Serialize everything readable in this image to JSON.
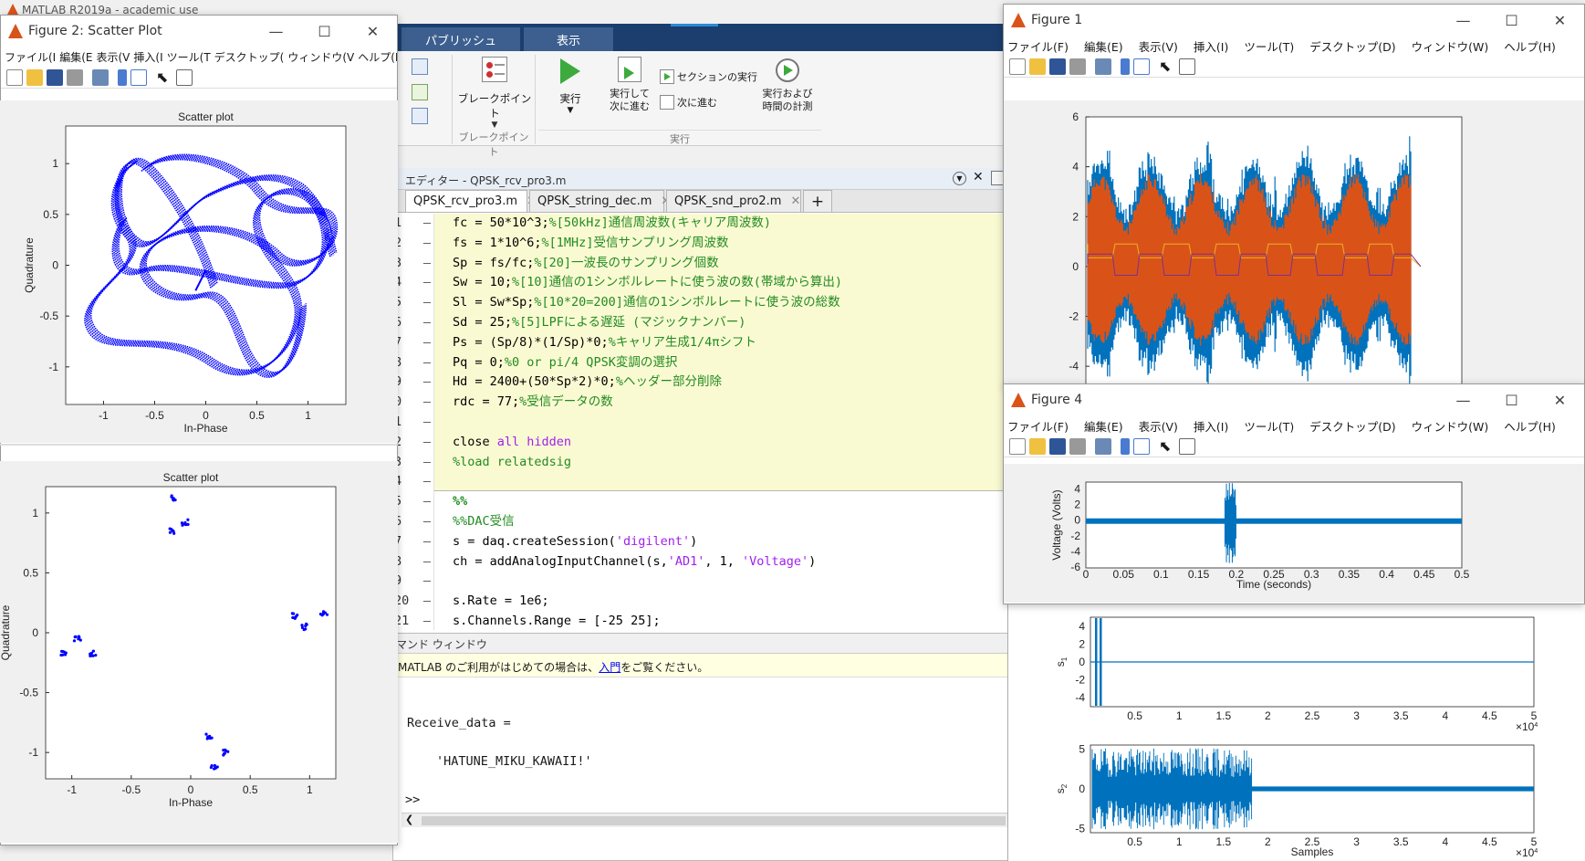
{
  "app": {
    "title": "MATLAB R2019a - academic use"
  },
  "ribbon": {
    "tabs": [
      "パブリッシュ",
      "表示"
    ],
    "breakpoint_label": "ブレークポイント",
    "breakpoint_group": "ブレークポイント",
    "run_label": "実行",
    "run_advance_label": "実行して\n次に進む",
    "run_section_label": "セクションの実行",
    "advance_label": "次に進む",
    "run_time_label": "実行および\n時間の計測",
    "run_group": "実行"
  },
  "editor": {
    "title": "エディター - QPSK_rcv_pro3.m",
    "tabs": [
      "QPSK_rcv_pro3.m",
      "QPSK_string_dec.m",
      "QPSK_snd_pro2.m"
    ],
    "plus": "+",
    "line_numbers": [
      "1",
      "2",
      "3",
      "4",
      "5",
      "6",
      "7",
      "8",
      "9",
      "0",
      "1",
      "2",
      "3",
      "4",
      "5",
      "6",
      "7",
      "8",
      "9",
      "20",
      "21"
    ],
    "lines": [
      [
        [
          "fc = 50*10^3;",
          "n"
        ],
        [
          "%[50kHz]通信周波数(キャリア周波数)",
          "c"
        ]
      ],
      [
        [
          "fs = 1*10^6;",
          "n"
        ],
        [
          "%[1MHz]受信サンプリング周波数",
          "c"
        ]
      ],
      [
        [
          "Sp = fs/fc;",
          "n"
        ],
        [
          "%[20]一波長のサンプリング個数",
          "c"
        ]
      ],
      [
        [
          "Sw = 10;",
          "n"
        ],
        [
          "%[10]通信の1シンボルレートに使う波の数(帯域から算出)",
          "c"
        ]
      ],
      [
        [
          "Sl = Sw*Sp;",
          "n"
        ],
        [
          "%[10*20=200]通信の1シンボルレートに使う波の総数",
          "c"
        ]
      ],
      [
        [
          "Sd = 25;",
          "n"
        ],
        [
          "%[5]LPFによる遅延 (マジックナンバー)",
          "c"
        ]
      ],
      [
        [
          "Ps = (Sp/8)*(1/Sp)*0;",
          "n"
        ],
        [
          "%キャリア生成1/4πシフト",
          "c"
        ]
      ],
      [
        [
          "Pq = 0;",
          "n"
        ],
        [
          "%0 or pi/4 QPSK変調の選択",
          "c"
        ]
      ],
      [
        [
          "Hd = 2400+(50*Sp*2)*0;",
          "n"
        ],
        [
          "%ヘッダー部分削除",
          "c"
        ]
      ],
      [
        [
          "rdc = 77;",
          "n"
        ],
        [
          "%受信データの数",
          "c"
        ]
      ],
      [],
      [
        [
          "close ",
          "n"
        ],
        [
          "all hidden",
          "k"
        ]
      ],
      [
        [
          "%load relatedsig",
          "c"
        ]
      ],
      [],
      [
        [
          "%%",
          "s"
        ]
      ],
      [
        [
          "%%DAC受信",
          "c"
        ]
      ],
      [
        [
          "s = daq.createSession(",
          "n"
        ],
        [
          "'digilent'",
          "t"
        ],
        [
          ")",
          "n"
        ]
      ],
      [
        [
          "ch = addAnalogInputChannel(s,",
          "n"
        ],
        [
          "'AD1'",
          "t"
        ],
        [
          ", 1, ",
          "n"
        ],
        [
          "'Voltage'",
          "t"
        ],
        [
          ")",
          "n"
        ]
      ],
      [],
      [
        [
          "s.Rate = 1e6;",
          "n"
        ]
      ],
      [
        [
          "s.Channels.Range = [-25 25];",
          "n"
        ]
      ]
    ]
  },
  "command": {
    "title": "マンド ウィンドウ",
    "notice_pre": "MATLAB のご利用がはじめての場合は、",
    "notice_link": "入門",
    "notice_post": "をご覧ください。",
    "output_var": "Receive_data =",
    "output_value": "'HATUNE_MIKU_KAWAII!'",
    "prompt": ">>"
  },
  "fig2": {
    "title": "Figure 2: Scatter Plot",
    "menu": [
      "ファイル(I",
      "編集(E",
      "表示(V",
      "挿入(I",
      "ツール(T",
      "デスクトップ(",
      "ウィンドウ(V",
      "ヘルプ(H"
    ]
  },
  "fig1": {
    "title": "Figure 1",
    "menu": [
      "ファイル(F)",
      "編集(E)",
      "表示(V)",
      "挿入(I)",
      "ツール(T)",
      "デスクトップ(D)",
      "ウィンドウ(W)",
      "ヘルプ(H)"
    ]
  },
  "fig4": {
    "title": "Figure 4",
    "menu": [
      "ファイル(F)",
      "編集(E)",
      "表示(V)",
      "挿入(I)",
      "ツール(T)",
      "デスクトップ(D)",
      "ウィンドウ(W)",
      "ヘルプ(H)"
    ]
  },
  "colors": {
    "matlab_blue": "#0072bd",
    "matlab_orange": "#d95319",
    "matlab_yellow": "#edb120",
    "matlab_purple": "#7e2f8e",
    "scatter_blue": "#0000ff",
    "code_comment": "#228b22",
    "code_string": "#a020f0",
    "editor_highlight": "#fafad2"
  },
  "chart_data": [
    {
      "type": "scatter",
      "title": "Scatter plot",
      "xlabel": "In-Phase",
      "ylabel": "Quadrature",
      "xlim": [
        -1.37,
        1.37
      ],
      "ylim": [
        -1.37,
        1.37
      ],
      "xticks": [
        "-1",
        "-0.5",
        "0",
        "0.5",
        "1"
      ],
      "yticks": [
        "1",
        "0.5",
        "0",
        "-0.5",
        "-1"
      ],
      "description": "dense looping trajectory of received constellation"
    },
    {
      "type": "scatter",
      "title": "Scatter plot",
      "xlabel": "In-Phase",
      "ylabel": "Quadrature",
      "xlim": [
        -1.22,
        1.22
      ],
      "ylim": [
        -1.22,
        1.22
      ],
      "xticks": [
        "-1",
        "-0.5",
        "0",
        "0.5",
        "1"
      ],
      "yticks": [
        "1",
        "0.5",
        "0",
        "-0.5",
        "-1"
      ],
      "clusters": [
        {
          "x": -0.15,
          "y": 0.85
        },
        {
          "x": -0.05,
          "y": 0.92
        },
        {
          "x": -0.14,
          "y": 1.12
        },
        {
          "x": 0.88,
          "y": 0.14
        },
        {
          "x": 1.12,
          "y": 0.16
        },
        {
          "x": 0.95,
          "y": 0.05
        },
        {
          "x": -1.06,
          "y": -0.18
        },
        {
          "x": -0.95,
          "y": -0.05
        },
        {
          "x": -0.82,
          "y": -0.17
        },
        {
          "x": 0.16,
          "y": -0.86
        },
        {
          "x": 0.3,
          "y": -1.0
        },
        {
          "x": 0.2,
          "y": -1.13
        }
      ]
    },
    {
      "type": "line",
      "title": "",
      "ylim": [
        -4.8,
        6
      ],
      "yticks": [
        "6",
        "4",
        "2",
        "0",
        "-2",
        "-4"
      ],
      "series": [
        {
          "color": "#0072bd"
        },
        {
          "color": "#d95319"
        },
        {
          "color": "#edb120"
        },
        {
          "color": "#7e2f8e"
        }
      ]
    },
    {
      "type": "line",
      "xlabel": "Time (seconds)",
      "ylabel": "Voltage (Volts)",
      "xlim": [
        0,
        0.5
      ],
      "ylim": [
        -6,
        5
      ],
      "xticks": [
        "0",
        "0.05",
        "0.1",
        "0.15",
        "0.2",
        "0.25",
        "0.3",
        "0.35",
        "0.4",
        "0.45",
        "0.5"
      ],
      "yticks": [
        "4",
        "2",
        "0",
        "-2",
        "-4",
        "-6"
      ],
      "burst": [
        0.185,
        0.2
      ]
    },
    {
      "type": "line",
      "ylabel": "s",
      "ylabel_sub": "1",
      "ylim": [
        -5,
        5
      ],
      "yticks": [
        "4",
        "2",
        "0",
        "-2",
        "-4"
      ],
      "xticks": [
        "0.5",
        "1",
        "1.5",
        "2",
        "2.5",
        "3",
        "3.5",
        "4",
        "4.5",
        "5"
      ],
      "exponent": "×10",
      "exponent_power": "4"
    },
    {
      "type": "line",
      "xlabel": "Samples",
      "ylabel": "s",
      "ylabel_sub": "2",
      "ylim": [
        -5.5,
        5.5
      ],
      "yticks": [
        "5",
        "0",
        "-5"
      ],
      "xticks": [
        "0.5",
        "1",
        "1.5",
        "2",
        "2.5",
        "3",
        "3.5",
        "4",
        "4.5",
        "5"
      ],
      "exponent": "×10",
      "exponent_power": "4"
    }
  ]
}
